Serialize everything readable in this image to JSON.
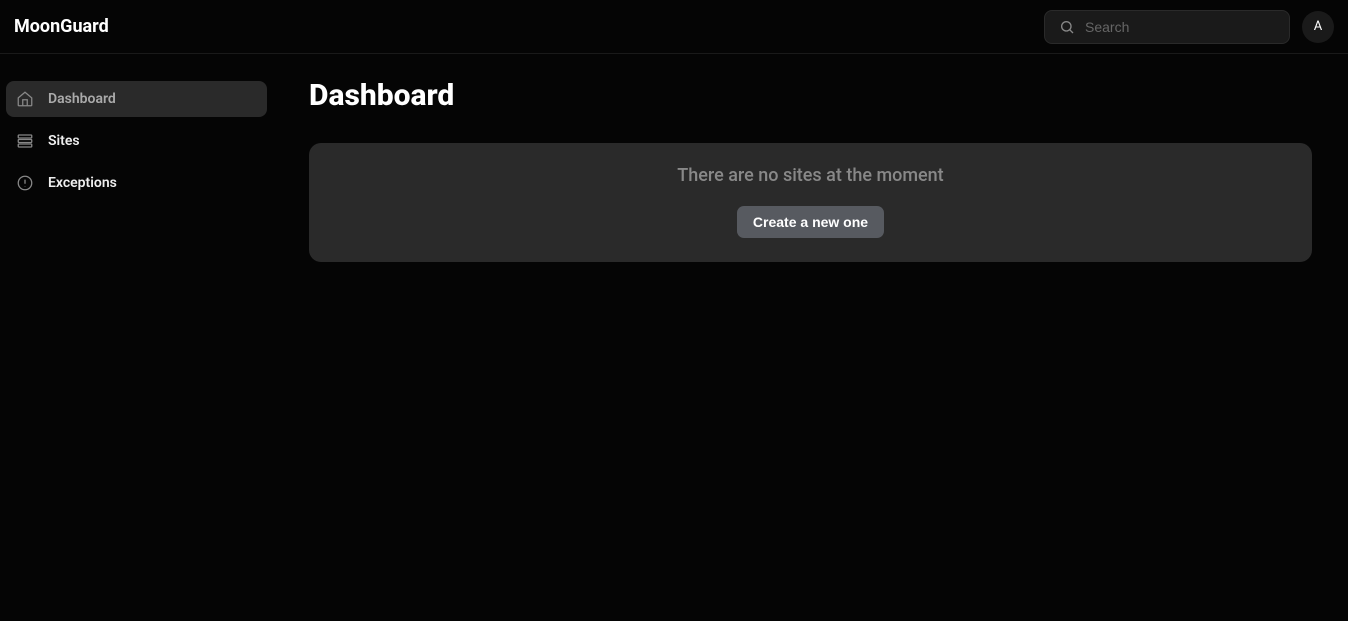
{
  "header": {
    "brand": "MoonGuard",
    "search_placeholder": "Search",
    "avatar_initial": "A"
  },
  "sidebar": {
    "items": [
      {
        "label": "Dashboard",
        "icon": "home-icon",
        "active": true
      },
      {
        "label": "Sites",
        "icon": "queue-icon",
        "active": false
      },
      {
        "label": "Exceptions",
        "icon": "alert-circle-icon",
        "active": false
      }
    ]
  },
  "main": {
    "title": "Dashboard",
    "empty_state": {
      "message": "There are no sites at the moment",
      "button_label": "Create a new one"
    }
  }
}
